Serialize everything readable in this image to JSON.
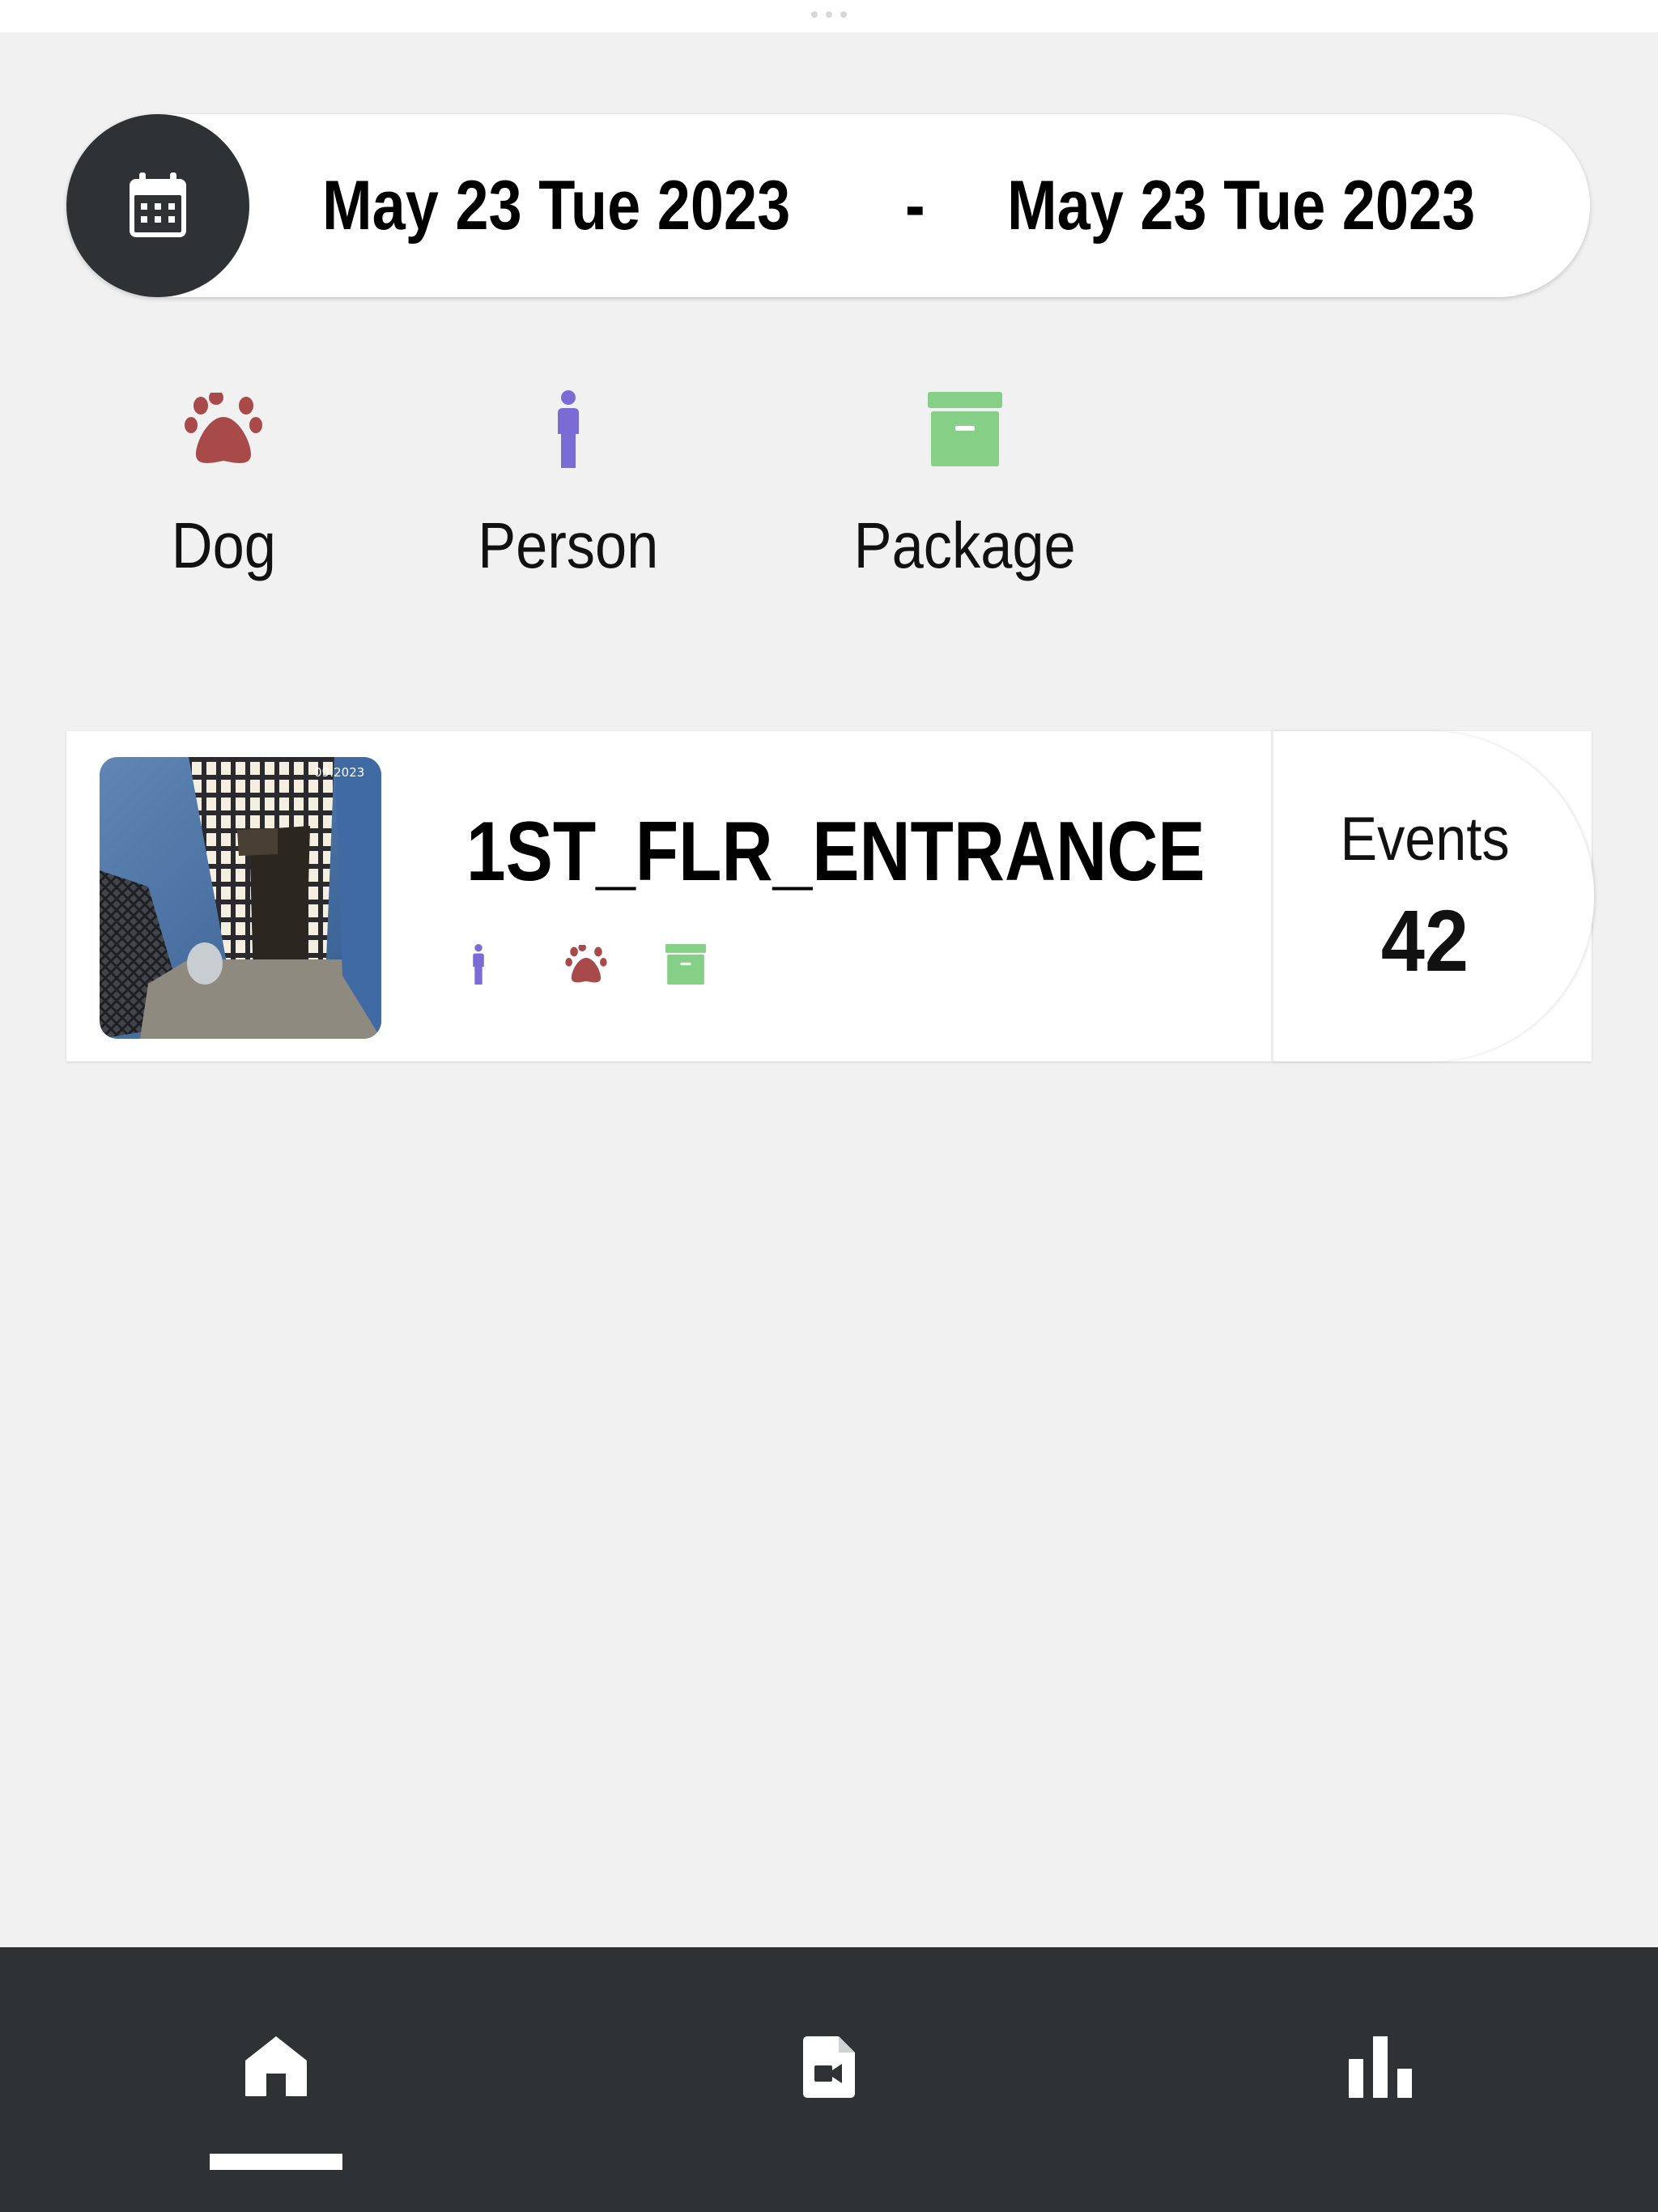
{
  "date_range": {
    "start": "May 23 Tue 2023",
    "separator": "-",
    "end": "May 23 Tue 2023",
    "calendar_icon": "calendar-icon"
  },
  "filters": [
    {
      "label": "Dog",
      "icon": "paw-icon",
      "color": "#a84a4a"
    },
    {
      "label": "Person",
      "icon": "person-icon",
      "color": "#7b6bd4"
    },
    {
      "label": "Package",
      "icon": "package-icon",
      "color": "#86cf86"
    }
  ],
  "cameras": [
    {
      "name": "1ST_FLR_ENTRANCE",
      "events_label": "Events",
      "events_count": "42",
      "detections": [
        "person-icon",
        "paw-icon",
        "package-icon"
      ]
    }
  ],
  "bottom_nav": {
    "items": [
      "home-icon",
      "video-file-icon",
      "bar-chart-icon"
    ],
    "active": "home-icon"
  },
  "colors": {
    "background": "#f1f1f1",
    "dark": "#2f3234",
    "dog": "#a84a4a",
    "person": "#7b6bd4",
    "package": "#86cf86"
  }
}
